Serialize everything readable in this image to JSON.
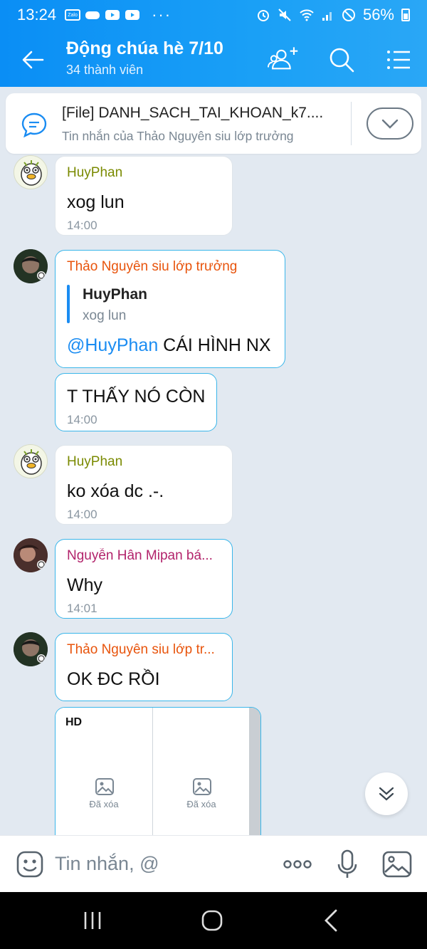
{
  "status": {
    "time": "13:24",
    "battery": "56%",
    "more": "···"
  },
  "header": {
    "title": "Động chúa hè 7/10",
    "subtitle": "34 thành viên"
  },
  "pinned": {
    "title": "[File] DANH_SACH_TAI_KHOAN_k7....",
    "subtitle": "Tin nhắn của Thảo Nguyên siu lớp trưởng"
  },
  "messages": {
    "m1": {
      "sender": "HuyPhan",
      "text": "xog lun",
      "time": "14:00"
    },
    "m2": {
      "sender": "Thảo Nguyên siu lớp trưởng",
      "quote_sender": "HuyPhan",
      "quote_text": "xog lun",
      "mention": "@HuyPhan",
      "text": " CÁI HÌNH NX"
    },
    "m3": {
      "text": "T THẤY NÓ CÒN",
      "time": "14:00"
    },
    "m4": {
      "sender": "HuyPhan",
      "text": "ko xóa dc .-.",
      "time": "14:00"
    },
    "m5": {
      "sender": "Nguyễn Hân Mipan bá...",
      "text": "Why",
      "time": "14:01"
    },
    "m6": {
      "sender": "Thảo Nguyên siu lớp tr...",
      "text": "OK ĐC RỒI"
    },
    "images": {
      "badge": "HD",
      "deleted_label": "Đã xóa"
    }
  },
  "input": {
    "placeholder": "Tin nhắn, @"
  },
  "colors": {
    "accent": "#0a8ef5",
    "sender_huy": "#7a8a00",
    "sender_thao": "#e8540c",
    "sender_han": "#b2236b",
    "mention": "#1a8cf2"
  }
}
